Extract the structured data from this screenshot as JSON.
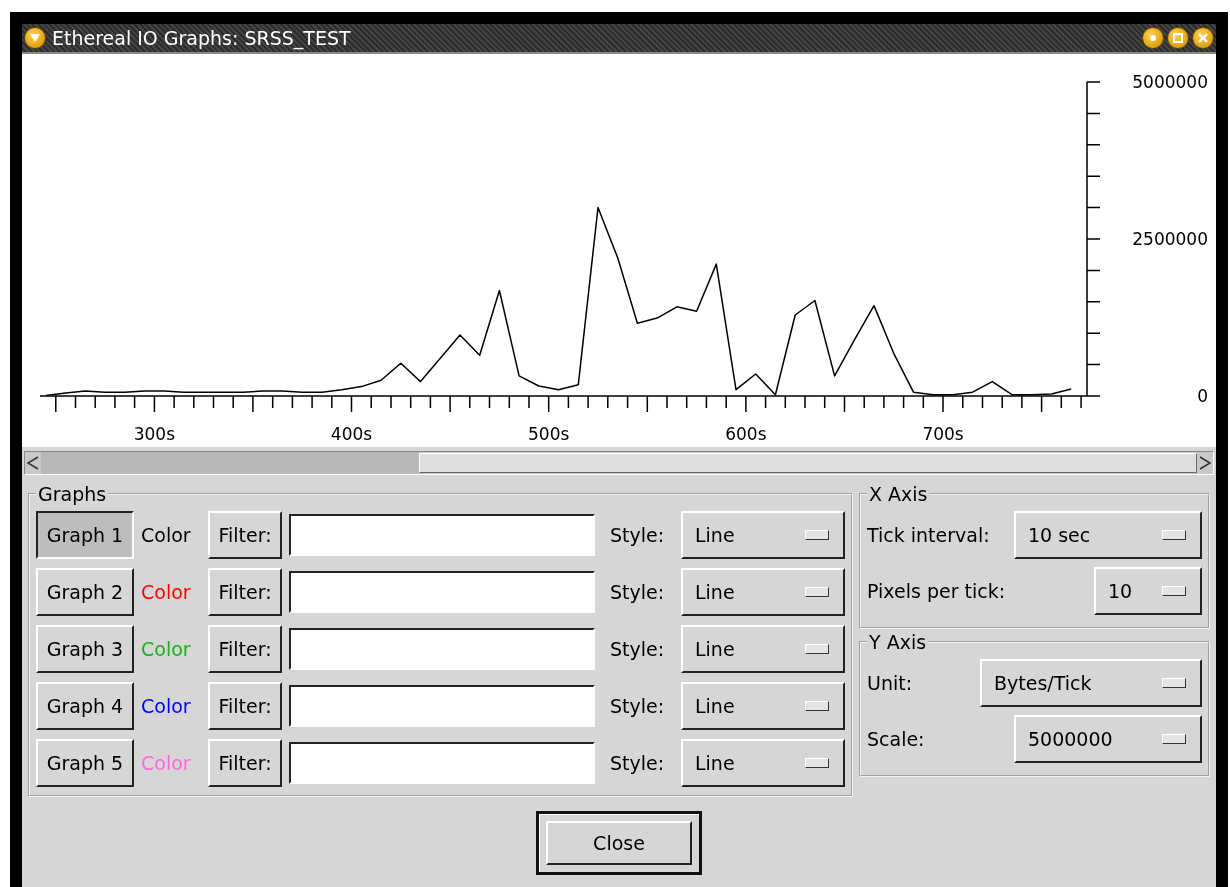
{
  "window": {
    "title": "Ethereal IO Graphs: SRSS_TEST"
  },
  "chart": {
    "chart_data": {
      "type": "line",
      "x": [
        245,
        255,
        265,
        275,
        285,
        295,
        305,
        315,
        325,
        335,
        345,
        355,
        365,
        375,
        385,
        395,
        405,
        415,
        425,
        435,
        445,
        455,
        465,
        475,
        485,
        495,
        505,
        515,
        525,
        535,
        545,
        555,
        565,
        575,
        585,
        595,
        605,
        615,
        625,
        635,
        645,
        655,
        665,
        675,
        685,
        695,
        705,
        715,
        725,
        735,
        745,
        755,
        765
      ],
      "series": [
        {
          "color": "#000000",
          "values": [
            10000,
            50000,
            80000,
            60000,
            60000,
            80000,
            80000,
            60000,
            60000,
            60000,
            60000,
            80000,
            80000,
            60000,
            60000,
            100000,
            150000,
            250000,
            520000,
            230000,
            600000,
            970000,
            650000,
            1680000,
            320000,
            160000,
            100000,
            180000,
            3000000,
            2200000,
            1160000,
            1240000,
            1420000,
            1350000,
            2100000,
            100000,
            350000,
            20000,
            1290000,
            1520000,
            320000,
            890000,
            1440000,
            680000,
            60000,
            20000,
            20000,
            60000,
            230000,
            20000,
            20000,
            30000,
            110000
          ]
        }
      ],
      "xlim": [
        242,
        772
      ],
      "ylim": [
        0,
        5000000
      ],
      "xticks": [
        {
          "value": 300,
          "label": "300s"
        },
        {
          "value": 400,
          "label": "400s"
        },
        {
          "value": 500,
          "label": "500s"
        },
        {
          "value": 600,
          "label": "600s"
        },
        {
          "value": 700,
          "label": "700s"
        }
      ],
      "yticks": [
        0,
        2500000,
        5000000
      ]
    }
  },
  "graphs": {
    "title": "Graphs",
    "rows": [
      {
        "label": "Graph 1",
        "selected": true,
        "color_label": "Color",
        "color": "#000000",
        "filter_label": "Filter:",
        "style_label": "Style:",
        "style": "Line"
      },
      {
        "label": "Graph 2",
        "selected": false,
        "color_label": "Color",
        "color": "#ff0000",
        "filter_label": "Filter:",
        "style_label": "Style:",
        "style": "Line"
      },
      {
        "label": "Graph 3",
        "selected": false,
        "color_label": "Color",
        "color": "#1ab01a",
        "filter_label": "Filter:",
        "style_label": "Style:",
        "style": "Line"
      },
      {
        "label": "Graph 4",
        "selected": false,
        "color_label": "Color",
        "color": "#0000ff",
        "filter_label": "Filter:",
        "style_label": "Style:",
        "style": "Line"
      },
      {
        "label": "Graph 5",
        "selected": false,
        "color_label": "Color",
        "color": "#ff66dd",
        "filter_label": "Filter:",
        "style_label": "Style:",
        "style": "Line"
      }
    ]
  },
  "x_axis": {
    "title": "X Axis",
    "fields": [
      {
        "label": "Tick interval:",
        "value": "10 sec"
      },
      {
        "label": "Pixels per tick:",
        "value": "10"
      }
    ]
  },
  "y_axis": {
    "title": "Y Axis",
    "fields": [
      {
        "label": "Unit:",
        "value": "Bytes/Tick"
      },
      {
        "label": "Scale:",
        "value": "5000000"
      }
    ]
  },
  "close_button": "Close"
}
